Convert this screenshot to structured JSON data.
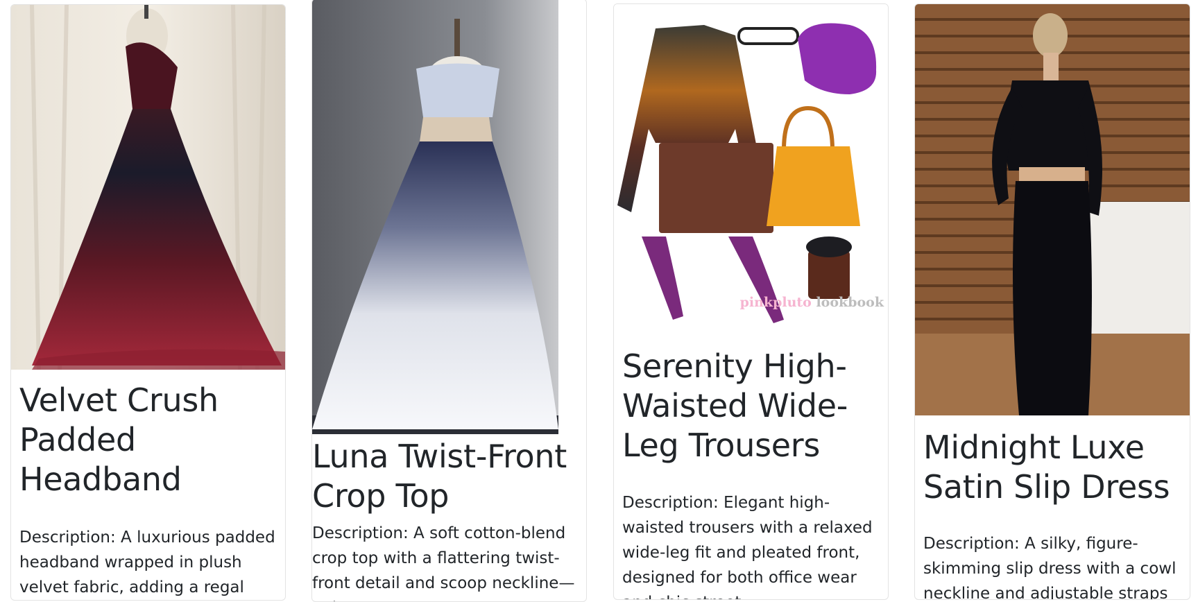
{
  "products": [
    {
      "title": "Velvet Crush Padded Headband",
      "description": "Description: A luxurious padded headband wrapped in plush velvet fabric, adding a regal touch to any"
    },
    {
      "title": "Luna Twist-Front Crop Top",
      "description": "Description: A soft cotton-blend crop top with a flattering twist-front detail and scoop neckline—pairs"
    },
    {
      "title": "Serenity High-Waisted Wide-Leg Trousers",
      "description": "Description: Elegant high-waisted trousers with a relaxed wide-leg fit and pleated front, designed for both office wear and chic street"
    },
    {
      "title": "Midnight Luxe Satin Slip Dress",
      "description": "Description: A silky, figure-skimming slip dress with a cowl neckline and adjustable straps"
    }
  ],
  "lookbook_watermark": {
    "brand": "pinkpluto",
    "word": "lookbook"
  }
}
